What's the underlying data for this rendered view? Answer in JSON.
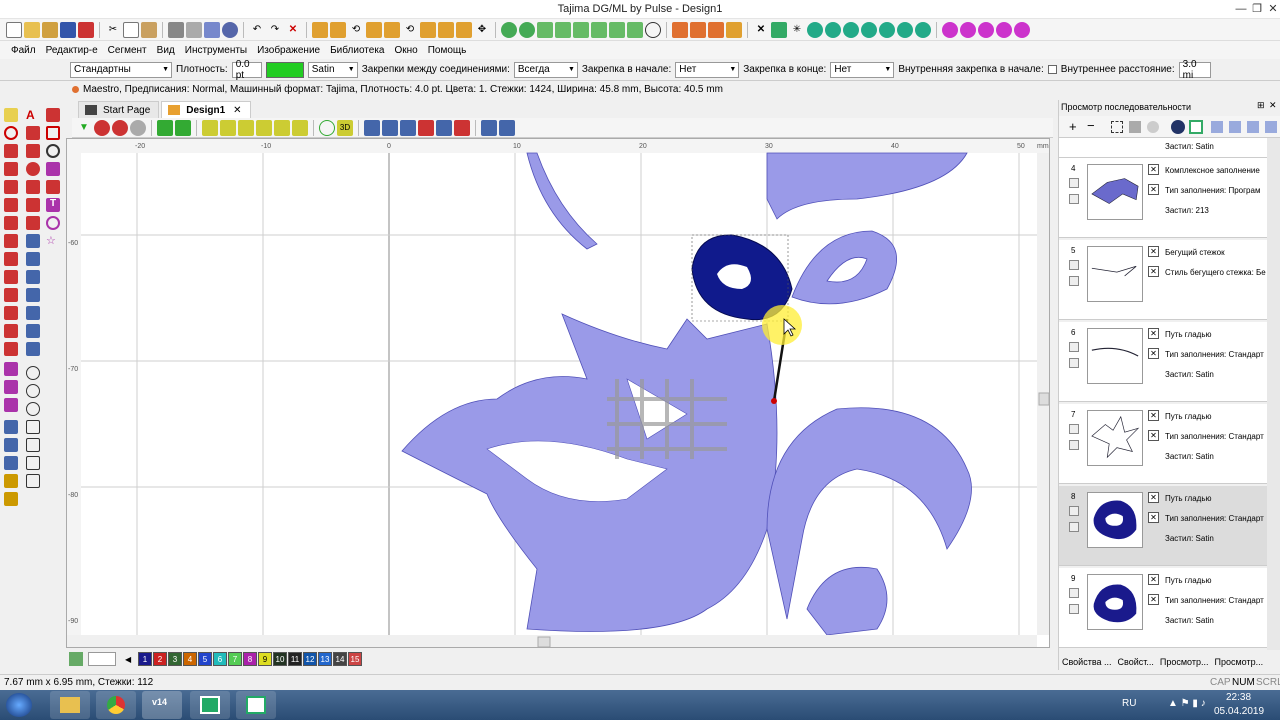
{
  "window": {
    "title": "Tajima DG/ML by Pulse - Design1"
  },
  "menu": [
    "Файл",
    "Редактир-е",
    "Сегмент",
    "Вид",
    "Инструменты",
    "Изображение",
    "Библиотека",
    "Окно",
    "Помощь"
  ],
  "props": {
    "style": "Стандартны",
    "density_label": "Плотность:",
    "density_value": "0.0 pt",
    "stitch_type": "Satin",
    "tie_between_label": "Закрепки между соединениями:",
    "tie_between_value": "Всегда",
    "tie_start_label": "Закрепка в начале:",
    "tie_start_value": "Нет",
    "tie_end_label": "Закрепка в конце:",
    "tie_end_value": "Нет",
    "inner_tie_label": "Внутренняя закрепка в начале:",
    "inner_dist_label": "Внутреннее расстояние:",
    "inner_dist_value": "3.0 mi",
    "accent_color": "#22cc22"
  },
  "status_info": "Maestro, Предписания: Normal, Машинный формат: Tajima, Плотность: 4.0 pt. Цвета: 1. Стежки: 1424, Ширина: 45.8 mm, Высота: 40.5 mm",
  "tabs": [
    {
      "label": "Start Page"
    },
    {
      "label": "Design1"
    }
  ],
  "ruler": {
    "top": [
      "-20",
      "-10",
      "0",
      "10",
      "20",
      "30",
      "40",
      "50",
      "mm"
    ],
    "left": [
      "-60",
      "-70",
      "-80",
      "-90"
    ]
  },
  "palette": [
    "1",
    "2",
    "3",
    "4",
    "5",
    "6",
    "7",
    "8",
    "9",
    "10",
    "11",
    "12",
    "13",
    "14",
    "15"
  ],
  "palette_colors": [
    "#1a1a8c",
    "#cc2222",
    "#336633",
    "#cc6600",
    "#2244cc",
    "#22bbbb",
    "#55cc55",
    "#aa22aa",
    "#dddd22",
    "#223322",
    "#222222",
    "#1155aa",
    "#2266cc",
    "#444444",
    "#cc4444"
  ],
  "sequence_panel": {
    "title": "Просмотр последовательности",
    "items": [
      {
        "num": "",
        "l1": "",
        "l2": "",
        "l3": "Застил: Satin"
      },
      {
        "num": "4",
        "l1": "Комплексное заполнение",
        "l2": "Тип заполнения: Програм",
        "l3": "Застил: 213"
      },
      {
        "num": "5",
        "l1": "Бегущий стежок",
        "l2": "Стиль бегущего стежка: Бе",
        "l3": ""
      },
      {
        "num": "6",
        "l1": "Путь гладью",
        "l2": "Тип заполнения: Стандарт",
        "l3": "Застил: Satin"
      },
      {
        "num": "7",
        "l1": "Путь гладью",
        "l2": "Тип заполнения: Стандарт",
        "l3": "Застил: Satin"
      },
      {
        "num": "8",
        "l1": "Путь гладью",
        "l2": "Тип заполнения: Стандарт",
        "l3": "Застил: Satin"
      },
      {
        "num": "9",
        "l1": "Путь гладью",
        "l2": "Тип заполнения: Стандарт",
        "l3": "Застил: Satin"
      }
    ],
    "bottom_tabs": [
      "Свойства ...",
      "Свойст...",
      "Просмотр...",
      "Просмотр..."
    ]
  },
  "bottom_status": {
    "coords": "7.67 mm x 6.95 mm, Стежки: 112",
    "cap": "CAP",
    "num": "NUM",
    "scrl": "SCRL"
  },
  "taskbar": {
    "lang": "RU",
    "time": "22:38",
    "date": "05.04.2019",
    "app_label": "v14"
  }
}
